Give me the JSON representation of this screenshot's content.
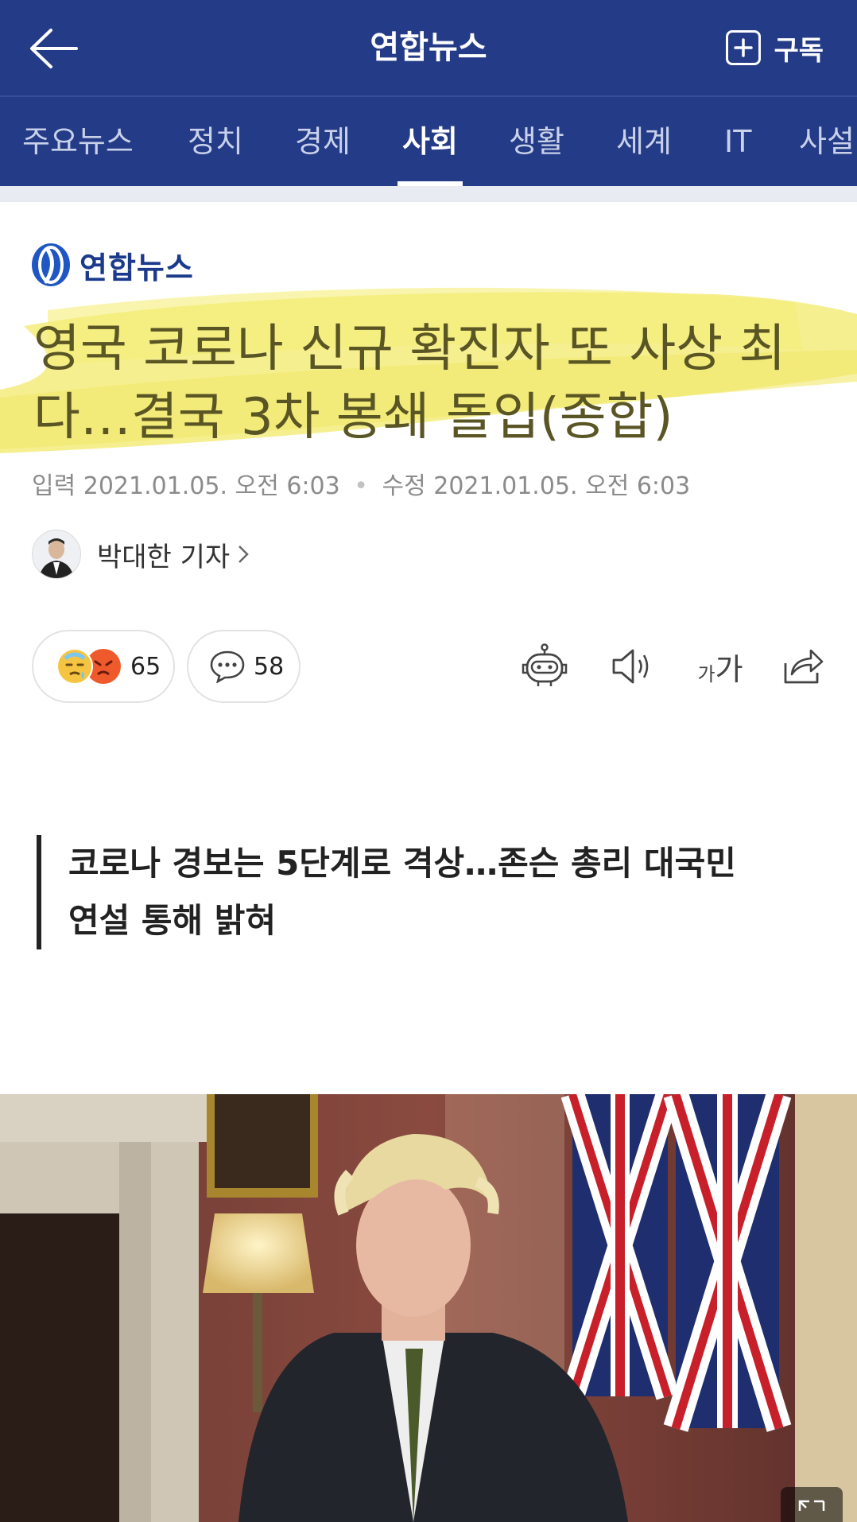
{
  "header": {
    "app_title": "연합뉴스",
    "subscribe_label": "구독"
  },
  "tabs": [
    {
      "label": "주요뉴스"
    },
    {
      "label": "정치"
    },
    {
      "label": "경제"
    },
    {
      "label": "사회",
      "active": true
    },
    {
      "label": "생활"
    },
    {
      "label": "세계"
    },
    {
      "label": "IT"
    },
    {
      "label": "사설"
    }
  ],
  "article": {
    "press_name": "연합뉴스",
    "headline_line1": "영국 코로나 신규 확진자 또 사상 최",
    "headline_line2": "다…결국 3차 봉쇄 돌입(종합)",
    "meta": {
      "input_label": "입력",
      "input_time": "2021.01.05. 오전 6:03",
      "edit_label": "수정",
      "edit_time": "2021.01.05. 오전 6:03"
    },
    "author": "박대한 기자",
    "reaction_count": "65",
    "comment_count": "58",
    "font_size_label_small": "가",
    "font_size_label_large": "가",
    "subheading_line1": "코로나 경보는 5단계로 격상…존슨 총리 대국민",
    "subheading_line2": "연설 통해 밝혀"
  },
  "colors": {
    "header_bg": "#243b87",
    "highlight": "#f3ea6a",
    "headline_text": "#5a5524"
  },
  "icons": [
    "back-arrow-icon",
    "plus-icon",
    "press-logo-icon",
    "chevron-right-icon",
    "emoji-reaction-icon",
    "comment-icon",
    "summary-bot-icon",
    "speaker-icon",
    "share-icon",
    "zoom-icon"
  ]
}
